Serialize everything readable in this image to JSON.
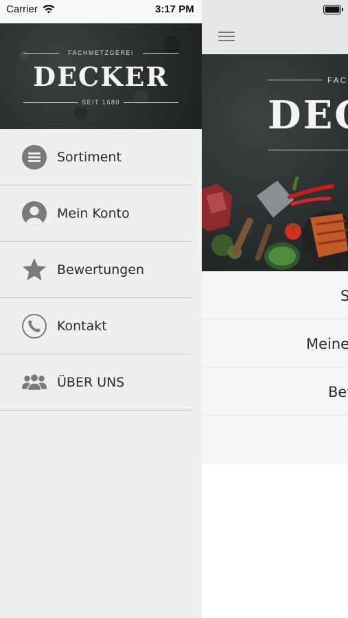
{
  "status_bar": {
    "carrier": "Carrier",
    "time": "3:17 PM"
  },
  "drawer": {
    "logo": {
      "supertitle": "FACHMETZGEREI",
      "name": "DECKER",
      "subtitle": "SEIT 1680"
    },
    "items": [
      {
        "label": "Sortiment",
        "icon": "list-icon"
      },
      {
        "label": "Mein Konto",
        "icon": "user-icon"
      },
      {
        "label": "Bewertungen",
        "icon": "star-icon"
      },
      {
        "label": "Kontakt",
        "icon": "phone-icon"
      },
      {
        "label": "ÜBER UNS",
        "icon": "group-icon"
      }
    ]
  },
  "main": {
    "hero": {
      "supertitle": "FACH",
      "name": "DEC"
    },
    "rows": [
      "S",
      "Meine",
      "Bev"
    ]
  },
  "colors": {
    "icon": "#7a7a7a",
    "drawer_bg": "#efefef",
    "divider": "#c9c9c9"
  }
}
